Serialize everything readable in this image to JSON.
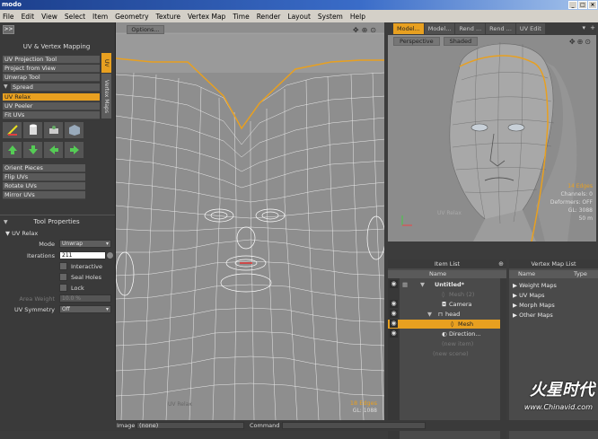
{
  "window": {
    "title": "modo"
  },
  "menu": [
    "File",
    "Edit",
    "View",
    "Select",
    "Item",
    "Geometry",
    "Texture",
    "Vertex Map",
    "Time",
    "Render",
    "Layout",
    "System",
    "Help"
  ],
  "left_panel": {
    "expand_label": ">>",
    "uv_title": "UV & Vertex Mapping",
    "tools": [
      "UV Projection Tool",
      "Project from View",
      "Unwrap Tool"
    ],
    "spread_label": "Spread",
    "tools2": [
      "UV Relax",
      "UV Peeler",
      "Fit UVs"
    ],
    "selected_tool": "UV Relax",
    "tools3": [
      "Orient Pieces",
      "Flip UVs",
      "Rotate UVs",
      "Mirror UVs"
    ],
    "vtabs": [
      "UV",
      "Vertex Maps"
    ],
    "tool_props_title": "Tool Properties",
    "tool_name": "UV Relax",
    "mode_label": "Mode",
    "mode_value": "Unwrap",
    "iterations_label": "Iterations",
    "iterations_value": "211",
    "interactive_label": "Interactive",
    "seal_holes_label": "Seal Holes",
    "lock_boundary_label": "Lock Boundary",
    "area_weight_label": "Area Weight",
    "area_weight_value": "10.0 %",
    "uv_symmetry_label": "UV Symmetry",
    "uv_symmetry_value": "Off"
  },
  "uv_viewport": {
    "options_label": "Options...",
    "watermark_label": "UV Relax",
    "edges": "18 Edges",
    "gl": "GL: 1088"
  },
  "status": {
    "image_label": "Image",
    "image_value": "(none)",
    "command_label": "Command"
  },
  "right_tabs": [
    "Model...",
    "Model...",
    "Rend ...",
    "Rend ...",
    "UV Edit"
  ],
  "view3d": {
    "view_mode": "Perspective",
    "shading": "Shaded",
    "edges": "14 Edges",
    "channels": "Channels: 0",
    "deformers": "Deformers: OFF",
    "gl": "GL: 3088",
    "distance": "50 m",
    "label": "UV Relax"
  },
  "item_list": {
    "title": "Item List",
    "col_name": "Name",
    "items": [
      {
        "label": "Untitled*",
        "ghost": false
      },
      {
        "label": "Mesh (2)",
        "ghost": true
      },
      {
        "label": "Camera",
        "ghost": false
      },
      {
        "label": "head",
        "ghost": false
      },
      {
        "label": "Mesh",
        "ghost": false
      },
      {
        "label": "Direction...",
        "ghost": false
      },
      {
        "label": "(new item)",
        "ghost": true
      },
      {
        "label": "(new scene)",
        "ghost": true
      }
    ]
  },
  "vertex_map_list": {
    "title": "Vertex Map List",
    "col_name": "Name",
    "col_type": "Type",
    "items": [
      "Weight Maps",
      "UV Maps",
      "Morph Maps",
      "Other Maps"
    ]
  },
  "watermark": {
    "logo": "火星时代",
    "site": "www.Chinavid.com"
  },
  "colors": {
    "accent": "#e8a020",
    "panel": "#3c3c3c",
    "viewport": "#8c8c8c"
  }
}
